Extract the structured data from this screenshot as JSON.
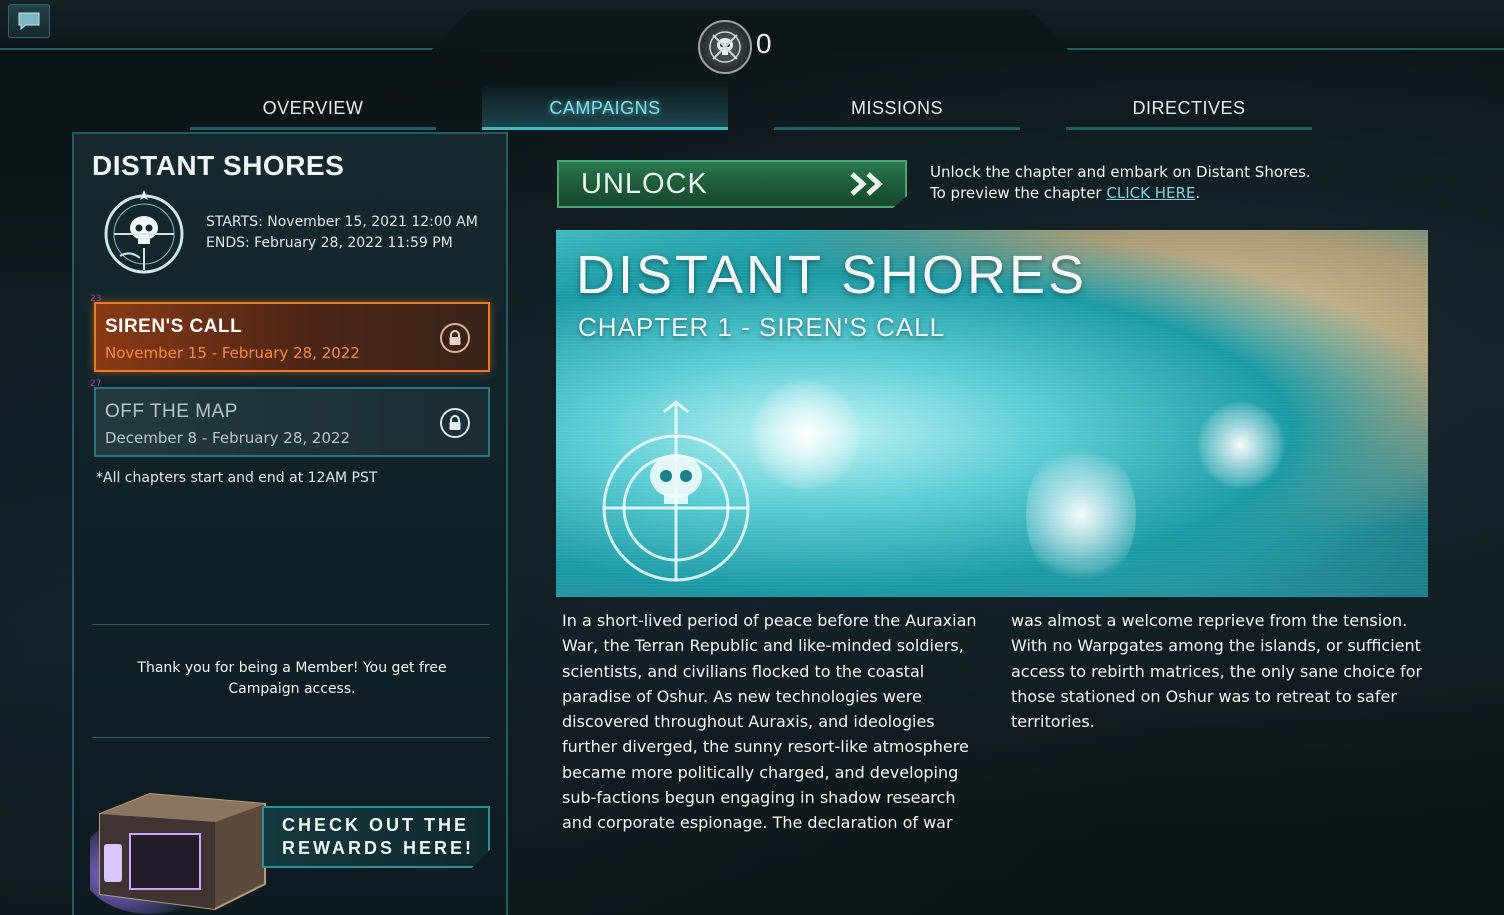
{
  "currency": {
    "value": "0",
    "icon": "skull-emblem-icon"
  },
  "tabs": [
    {
      "label": "OVERVIEW"
    },
    {
      "label": "CAMPAIGNS"
    },
    {
      "label": "MISSIONS"
    },
    {
      "label": "DIRECTIVES"
    }
  ],
  "campaign": {
    "title": "DISTANT SHORES",
    "starts": "STARTS: November 15, 2021 12:00 AM",
    "ends": "ENDS: February 28, 2022 11:59 PM"
  },
  "chapters": [
    {
      "num": "23",
      "name": "SIREN'S CALL",
      "dates": "November 15 - February 28, 2022",
      "state": "active"
    },
    {
      "num": "27",
      "name": "OFF THE MAP",
      "dates": "December 8 - February 28, 2022",
      "state": "inactive"
    }
  ],
  "footnote": "*All chapters start and end at 12AM PST",
  "member_text": "Thank you for being a Member! You get free Campaign access.",
  "rewards": {
    "line1": "CHECK OUT THE",
    "line2": "REWARDS HERE!"
  },
  "unlock": {
    "label": "UNLOCK",
    "info_line1": "Unlock the chapter and embark on Distant Shores.",
    "info_line2_prefix": "To preview the chapter ",
    "info_link": "CLICK HERE",
    "info_line2_suffix": "."
  },
  "hero": {
    "title": "DISTANT SHORES",
    "subtitle": "CHAPTER 1 - SIREN'S CALL"
  },
  "description": {
    "col1": "In a short-lived period of peace before the Auraxian War, the Terran Republic and like-minded soldiers, scientists, and civilians flocked to the coastal paradise of Oshur. As new technologies were discovered throughout Auraxis, and ideologies further diverged, the sunny resort-like atmosphere became more politically charged, and developing sub-factions begun engaging in shadow research and corporate espionage. The declaration of war",
    "col2": "was almost a welcome reprieve from the tension. With no Warpgates among the islands, or sufficient access to rebirth matrices, the only sane choice for those stationed on Oshur was to retreat to safer territories."
  },
  "colors": {
    "accent": "#3fb6c4",
    "active_chapter": "#f07a2a",
    "unlock_green": "#2a7a4f"
  }
}
